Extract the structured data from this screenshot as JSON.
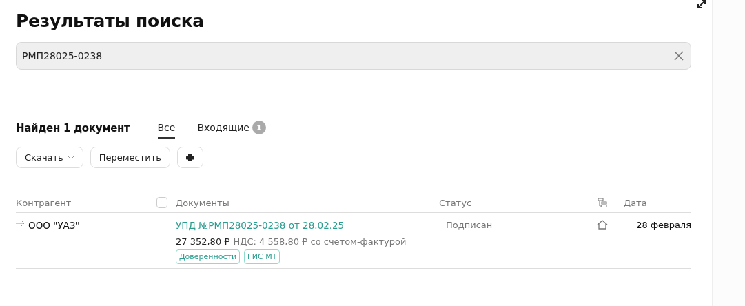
{
  "title": "Результаты поиска",
  "search": {
    "value": "РМП28025-0238"
  },
  "found_label": "Найден 1 документ",
  "tabs": [
    {
      "label": "Все",
      "selected": true
    },
    {
      "label": "Входящие",
      "selected": false,
      "badge": "1"
    }
  ],
  "toolbar": [
    {
      "kind": "dropdown",
      "label": "Скачать"
    },
    {
      "kind": "text",
      "label": "Переместить"
    },
    {
      "kind": "print"
    }
  ],
  "table": {
    "columns": [
      {
        "kind": "text",
        "label": "Контрагент"
      },
      {
        "kind": "checkbox",
        "checked": false,
        "label": "Документы"
      },
      {
        "kind": "text",
        "label": "Статус"
      },
      {
        "kind": "tree"
      },
      {
        "kind": "text",
        "label": "Дата"
      }
    ],
    "rows": [
      {
        "counterparty": "ООО \"УАЗ\"",
        "document": "УПД №РМП28025-0238 от 28.02.25",
        "amount": "27 352,80 ₽",
        "vat": "НДС: 4 558,80 ₽ со счетом-фактурой",
        "tags": [
          "Доверенности",
          "ГИС МТ"
        ],
        "status": "Подписан",
        "date": "28 февраля"
      }
    ]
  }
}
